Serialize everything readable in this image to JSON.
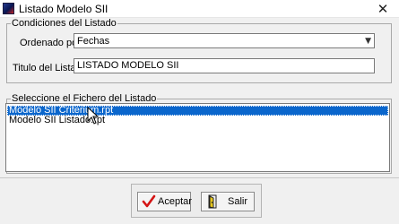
{
  "window": {
    "title": "Listado Modelo SII",
    "close_glyph": "✕"
  },
  "conditions": {
    "group_label": "Condiciones del Listado",
    "order_label": "Ordenado por",
    "order_value": "Fechas",
    "title_label": "Titulo del Listado",
    "title_value": "LISTADO MODELO SII"
  },
  "files": {
    "group_label": "Seleccione el Fichero del Listado",
    "items": [
      {
        "label": "Modelo SII Criterium.rpt",
        "selected": true
      },
      {
        "label": "Modelo SII Listado.rpt",
        "selected": false
      }
    ]
  },
  "buttons": {
    "accept_label": "Aceptar",
    "exit_label": "Salir"
  },
  "colors": {
    "selection": "#0a66cc",
    "accept_check": "#d41414",
    "exit_door": "#e8c81c"
  },
  "icons": {
    "app": "app-icon",
    "combo_arrow": "chevron-down-icon",
    "accept": "checkmark-icon",
    "exit": "door-exit-icon",
    "cursor": "mouse-cursor-icon"
  }
}
